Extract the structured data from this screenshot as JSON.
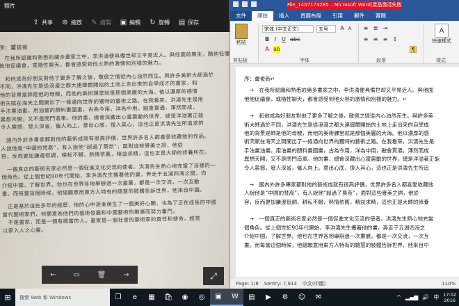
{
  "photos": {
    "title": "照片",
    "toolbar": [
      {
        "label": "共享",
        "icon": "share-icon",
        "glyph": "⇪",
        "enabled": true
      },
      {
        "label": "縮放",
        "icon": "zoom-icon",
        "glyph": "⊕",
        "enabled": true
      },
      {
        "label": "繪製",
        "icon": "draw-icon",
        "glyph": "✎",
        "enabled": false
      },
      {
        "label": "編輯",
        "icon": "edit-icon",
        "glyph": "▣",
        "enabled": true
      },
      {
        "label": "旋轉",
        "icon": "rotate-icon",
        "glyph": "↻",
        "enabled": true
      },
      {
        "label": "保存",
        "icon": "save-icon",
        "glyph": "▤",
        "enabled": true
      }
    ],
    "page_lines": [
      "序：薑俊新",
      "　在我所認識和熟悉的諸多畫家之中，李洪濤便具備世却又平易近人。與他面前無生，酷他低懂議，",
      "他他促議會，或隨性聊天，都會感受到他火熱的激情和別樣的魅力。",
      "　和他成為好朋友對他了更多了解之後，敬佩之情從內心油然而生。與許多美術大師過於",
      "不同，洪濤先生是從浪漫之都大連瑯爾開始的土地上走出來的自學成才的畫家，和",
      "他的背景是師是他的母親，而他的美術課堂就是那個美麗的大海。他以濃厚的感情",
      "術天賦在海天之間開出了一條通向世界的獨特的藝術之路。在我看來，洪濤先生是用",
      "手法畫油畫，用油畫的顏料畫國畫，古為今用，洋為中用，融會貫通，渾然而成，",
      "異想天開，又不是閉門造車。他的畫，總會深藏出心靈震動的世界，總是洋溢著正能",
      "令人震撼，發人深省，催人向上。意出心底，復入其心，這也正是洪濤先生所追求的",
      "　國內外許多專家都對他的藝術成就有很高評價，世界許多名人都喜愛收藏他的作品。",
      "人說他是“中國的梵高”，有人說他“超過了莫奈”，面對這些譽美之詞，他從",
      "容，反而更加謙遜低調，耕耘不輟，熱情依舊，精益求精，這也正是大師的修養所在。",
      "　一個真正的藝術名家必然是一個促進文化交流的使者。洪濤先生熱心地充當了這樣的一",
      "個角色。從上個世紀90年代開始，李洪濤先生攜著他的畫，奔走于五湖四海之間，向",
      "介紹中國，了解世界。他也在世界各地舉辦過一次畫展，都是一次交流，一次互動",
      "畫。而每當這個時候，他總願意用東方人特有的聰慧的肢體告訴世界，他來自中國。",
      "　正是基於這些多年的經歷，他的心中逐漸萌生了一個美好心願，也為了正在成長的中國",
      "當代藝術家們，他願意為他們的藝術發展和中國藝術的推廣而努力奮鬥。",
      "　不是畫家，而是一個有擔當的人。畫家是一個社會的藝術家的責任和使命，經常",
      "以家入人之心靈。"
    ],
    "nav": {
      "prev_glyph": "←",
      "open_glyph": "▭",
      "delete_glyph": "🗑",
      "next_glyph": "→"
    },
    "expand_glyph": "⤢"
  },
  "word": {
    "window_title": "File_1457173285 – Microsoft Word[產品激活失敗]",
    "tabs": [
      "文件",
      "開始",
      "插入",
      "頁面布局",
      "引用",
      "郵件",
      "審閱"
    ],
    "active_tab": "開始",
    "ribbon": {
      "paste_label": "粘貼",
      "clipboard_label": "剪貼板",
      "font_name": "宋体 (中文正文)",
      "font_size": "五号",
      "font_group_label": "字体",
      "paragraph_label": "段落",
      "quick_styles_label": "快速樣式",
      "styles_label": "樣式",
      "bold": "B",
      "italic": "I",
      "underline": "U"
    },
    "doc_lines": [
      {
        "text": "序：薑俊新↵",
        "cls": "title"
      },
      {
        "text": "　→　在我所認識和熟悉的諸多畫家之中，李洪濤便具備世却又平易近人。與他面",
        "cls": ""
      },
      {
        "text": "他他促議會，或隨性聊天，都會感受到他火熱的激情和別樣的魅力。↵",
        "cls": ""
      },
      {
        "text": "　→　和他成為好朋友對他了更多了解之後，敬佩之情從內心油然而生。與許多美",
        "cls": "gap"
      },
      {
        "text": "術大師過於不同，洪濤先生是從浪漫之都大連瑯爾開始的土地上走出來的自學成",
        "cls": ""
      },
      {
        "text": "他的背景是師是他的母親，而他的美術課堂就是那個美麗的大海。他以濃厚的感",
        "cls": ""
      },
      {
        "text": "術天賦在海天之間開出了一條通向世界的獨特的藝術之路。在我看來，洪濤先生是",
        "cls": ""
      },
      {
        "text": "手法畫油畫，用油畫的顏料畫國畫，古為今用，洋為中用，融會貫通，渾然而成",
        "cls": ""
      },
      {
        "text": "異想天開，又不是閉門造車。他的畫，總會深藏出心靈震動的世界，總是洋溢著正能",
        "cls": ""
      },
      {
        "text": "令人震撼，發人深省，催人向上。意出心底，復入其心，這也正是洪濤先生所追",
        "cls": ""
      },
      {
        "text": "　→　國內外許多專家都對他的藝術成就有很高評價，世界許多名人都喜愛收藏他",
        "cls": "gap"
      },
      {
        "text": "人說他是“中國的梵高”，有人說他“超過了莫奈”，面對這些譽美之詞，他從",
        "cls": ""
      },
      {
        "text": "容，反而更加謙遜低調，耕耘不輟，熱情依舊，精益求精，這也正是大師的修養",
        "cls": ""
      },
      {
        "text": "　→　一個真正的藝術名家必然是一個促進文化交流的使者。洪濤先生熱心地充當",
        "cls": "gap"
      },
      {
        "text": "個角色。從上個世紀90年代開始，李洪濤先生攜著他的畫，奔走于五湖四海之",
        "cls": ""
      },
      {
        "text": "介紹中國，了解世界。他也在世界各地舉辦過一次畫展，都是一次交流，一次互",
        "cls": ""
      },
      {
        "text": "畫。而每當這個時候，他總願意用東方人特有的聰慧的肢體告訴世界，他來自中",
        "cls": ""
      }
    ],
    "status": {
      "page": "Page: 1/8",
      "words": "Sentry: 7,913",
      "language": "中文(中國)",
      "zoom": "110%"
    }
  },
  "taskbar": {
    "search_placeholder": "搜索 Web 和 Windows",
    "apps": [
      {
        "name": "task-view-icon",
        "glyph": "❐",
        "active": false
      },
      {
        "name": "edge-icon",
        "glyph": "e",
        "active": false
      },
      {
        "name": "file-explorer-icon",
        "glyph": "▦",
        "active": false
      },
      {
        "name": "store-icon",
        "glyph": "🛍",
        "active": false
      },
      {
        "name": "chrome-icon",
        "glyph": "◉",
        "active": false
      },
      {
        "name": "qq-icon",
        "glyph": "◎",
        "active": false
      },
      {
        "name": "photos-icon",
        "glyph": "▣",
        "active": true
      },
      {
        "name": "word-icon",
        "glyph": "W",
        "active": true
      },
      {
        "name": "calculator-icon",
        "glyph": "▤",
        "active": false
      },
      {
        "name": "media-icon",
        "glyph": "▶",
        "active": false
      },
      {
        "name": "settings-icon",
        "glyph": "⚙",
        "active": false
      },
      {
        "name": "people-icon",
        "glyph": "☺",
        "active": false
      },
      {
        "name": "mail-icon",
        "glyph": "✉",
        "active": false
      }
    ],
    "tray": {
      "arrow": "^",
      "network": "▂▄▆",
      "volume": "🔊",
      "ime": "中",
      "time": "17:02",
      "date": "2016"
    }
  }
}
